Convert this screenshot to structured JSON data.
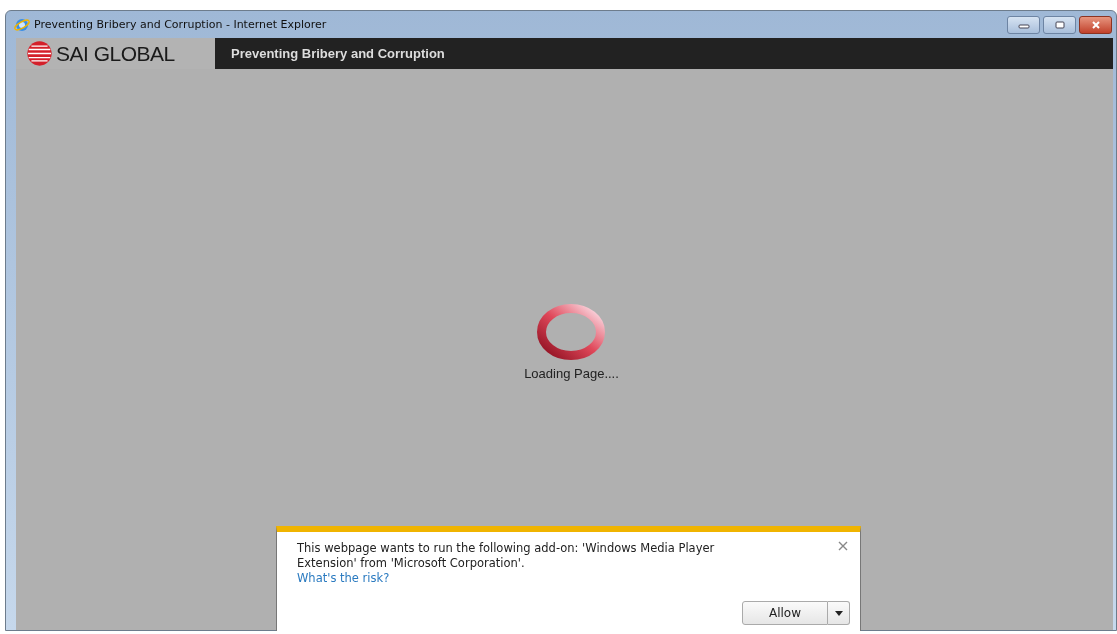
{
  "window": {
    "title": "Preventing Bribery and Corruption - Internet Explorer"
  },
  "header": {
    "logo_text": "SAI GLOBAL",
    "course_title": "Preventing Bribery and Corruption"
  },
  "loading": {
    "label": "Loading Page...."
  },
  "notification": {
    "message": "This webpage wants to run the following add-on: 'Windows Media Player Extension' from 'Microsoft Corporation'.",
    "link": "What's the risk?",
    "button": "Allow"
  }
}
